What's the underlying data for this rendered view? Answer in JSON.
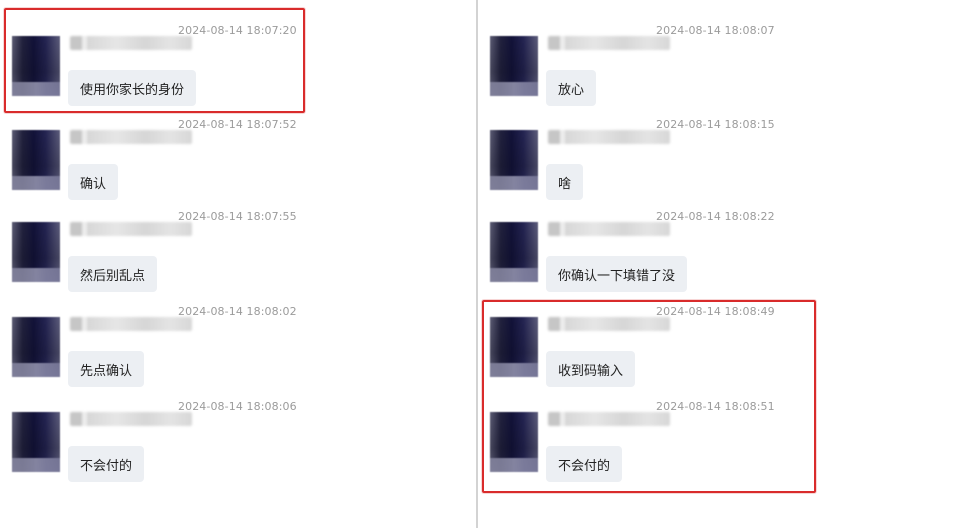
{
  "left_panel": {
    "messages": [
      {
        "timestamp": "2024-08-14 18:07:20",
        "text": "使用你家长的身份"
      },
      {
        "timestamp": "2024-08-14 18:07:52",
        "text": "确认"
      },
      {
        "timestamp": "2024-08-14 18:07:55",
        "text": "然后别乱点"
      },
      {
        "timestamp": "2024-08-14 18:08:02",
        "text": "先点确认"
      },
      {
        "timestamp": "2024-08-14 18:08:06",
        "text": "不会付的"
      }
    ]
  },
  "right_panel": {
    "messages": [
      {
        "timestamp": "2024-08-14 18:08:07",
        "text": "放心"
      },
      {
        "timestamp": "2024-08-14 18:08:15",
        "text": "啥"
      },
      {
        "timestamp": "2024-08-14 18:08:22",
        "text": "你确认一下填错了没"
      },
      {
        "timestamp": "2024-08-14 18:08:49",
        "text": "收到码输入"
      },
      {
        "timestamp": "2024-08-14 18:08:51",
        "text": "不会付的"
      }
    ]
  },
  "colors": {
    "highlight": "#d92b2b",
    "bubble": "#eceff3",
    "timestamp": "#9b9b9b"
  }
}
